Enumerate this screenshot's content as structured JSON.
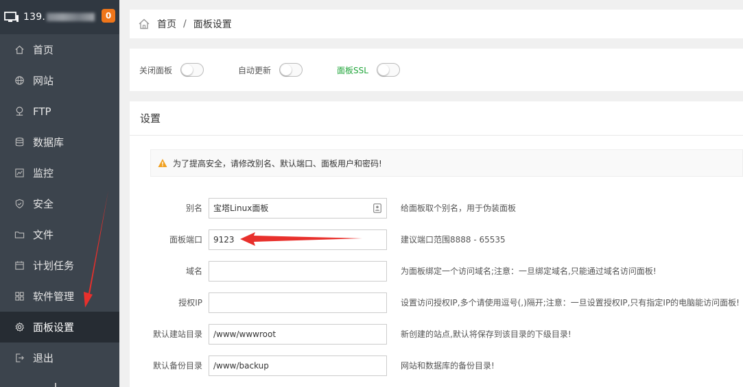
{
  "sidebar": {
    "ip_prefix": "139.",
    "badge_count": "0",
    "items": [
      {
        "label": "首页",
        "icon": "home-icon"
      },
      {
        "label": "网站",
        "icon": "globe-icon"
      },
      {
        "label": "FTP",
        "icon": "ftp-icon"
      },
      {
        "label": "数据库",
        "icon": "database-icon"
      },
      {
        "label": "监控",
        "icon": "monitor-chart-icon"
      },
      {
        "label": "安全",
        "icon": "shield-icon"
      },
      {
        "label": "文件",
        "icon": "folder-icon"
      },
      {
        "label": "计划任务",
        "icon": "calendar-icon"
      },
      {
        "label": "软件管理",
        "icon": "grid-icon"
      },
      {
        "label": "面板设置",
        "icon": "gear-icon"
      },
      {
        "label": "退出",
        "icon": "logout-icon"
      }
    ],
    "active_index": 9
  },
  "breadcrumb": {
    "home": "首页",
    "separator": "/",
    "current": "面板设置"
  },
  "toggles": {
    "close_panel": "关闭面板",
    "auto_update": "自动更新",
    "panel_ssl": "面板SSL"
  },
  "settings": {
    "title": "设置",
    "warning": "为了提高安全，请修改别名、默认端口、面板用户和密码!",
    "fields": [
      {
        "label": "别名",
        "value": "宝塔Linux面板",
        "tip": "给面板取个别名，用于伪装面板"
      },
      {
        "label": "面板端口",
        "value": "9123",
        "tip": "建议端口范围8888 - 65535"
      },
      {
        "label": "域名",
        "value": "",
        "tip": "为面板绑定一个访问域名;注意：一旦绑定域名,只能通过域名访问面板!"
      },
      {
        "label": "授权IP",
        "value": "",
        "tip": "设置访问授权IP,多个请使用逗号(,)隔开;注意：一旦设置授权IP,只有指定IP的电脑能访问面板!"
      },
      {
        "label": "默认建站目录",
        "value": "/www/wwwroot",
        "tip": "新创建的站点,默认将保存到该目录的下级目录!"
      },
      {
        "label": "默认备份目录",
        "value": "/www/backup",
        "tip": "网站和数据库的备份目录!"
      }
    ]
  },
  "colors": {
    "sidebar_bg": "#3c444d",
    "sidebar_active": "#262c33",
    "badge": "#f0761a",
    "ssl_green": "#20a53a",
    "arrow_red": "#e8302c"
  }
}
